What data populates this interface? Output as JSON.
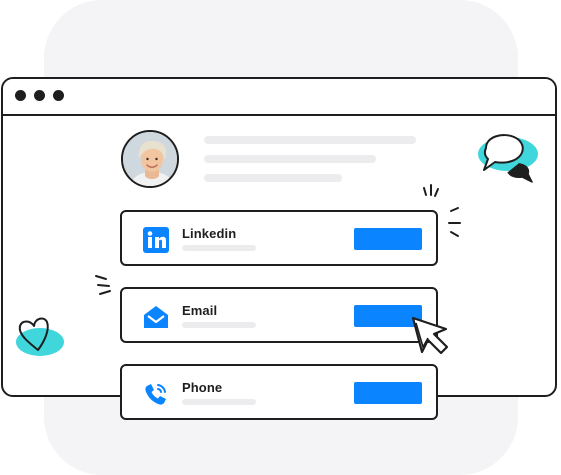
{
  "colors": {
    "accent": "#0a84ff",
    "teal": "#3fd6dc",
    "orange": "#f5a623",
    "ink": "#1e1e1e",
    "skeleton": "#ececef"
  },
  "contacts": [
    {
      "label": "Linkedin",
      "icon": "linkedin-icon"
    },
    {
      "label": "Email",
      "icon": "envelope-icon"
    },
    {
      "label": "Phone",
      "icon": "phone-icon"
    }
  ],
  "decorations": [
    "chat-bubbles-icon",
    "heart-icon",
    "mouse-cursor-icon",
    "sparkle-icon"
  ]
}
